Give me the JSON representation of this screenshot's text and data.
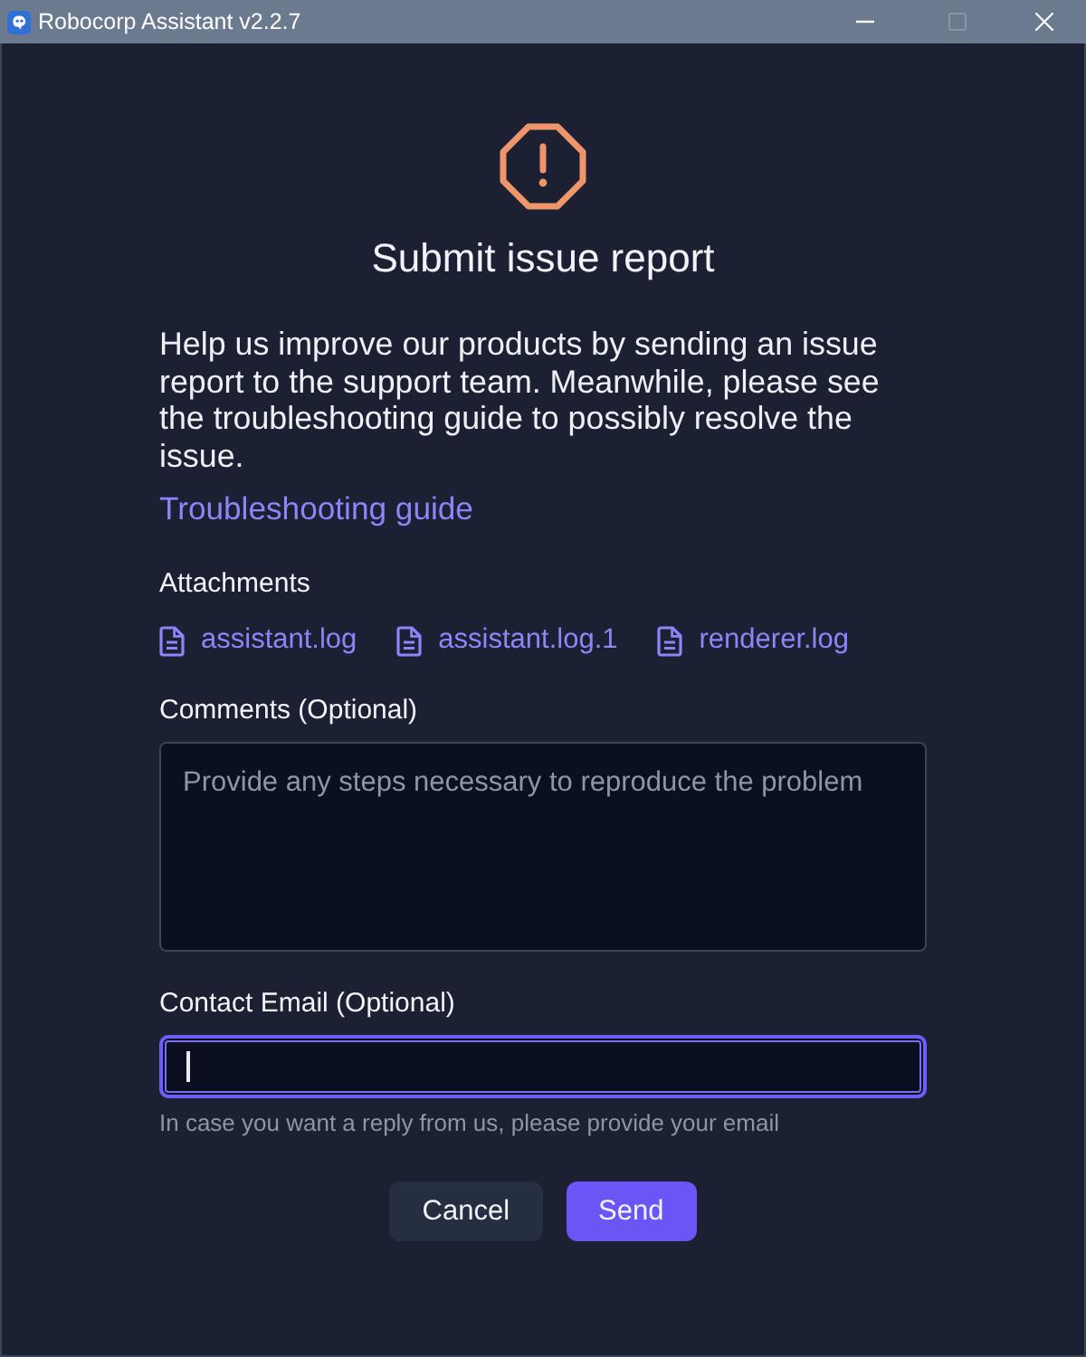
{
  "window": {
    "title": "Robocorp Assistant v2.2.7",
    "controls": [
      {
        "kind": "minimize",
        "disabled": false
      },
      {
        "kind": "maximize",
        "disabled": true
      },
      {
        "kind": "close",
        "disabled": false
      }
    ]
  },
  "dialog": {
    "title": "Submit issue report",
    "description": "Help us improve our products by sending an issue report to the support team. Meanwhile, please see the troubleshooting guide to possibly resolve the issue.",
    "link": "Troubleshooting guide"
  },
  "attachments": {
    "label": "Attachments",
    "files": [
      "assistant.log",
      "assistant.log.1",
      "renderer.log"
    ]
  },
  "fields": [
    {
      "kind": "textarea",
      "label": "Comments (Optional)",
      "placeholder": "Provide any steps necessary to reproduce the problem",
      "focused": false
    },
    {
      "kind": "input",
      "label": "Contact Email (Optional)",
      "focused": true,
      "hint": "In case you want a reply from us, please provide your email"
    }
  ],
  "buttons": [
    {
      "label": "Cancel",
      "kind": "secondary"
    },
    {
      "label": "Send",
      "kind": "primary"
    }
  ]
}
